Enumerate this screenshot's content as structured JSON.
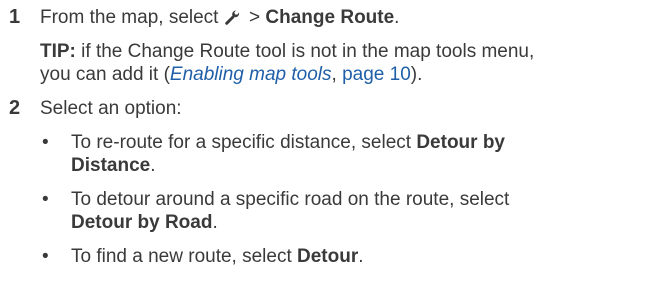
{
  "steps": [
    {
      "number": "1",
      "text_before": "From the map, select ",
      "icon": "wrench-icon",
      "separator": " > ",
      "action": "Change Route",
      "text_after": "."
    },
    {
      "number": "2",
      "text": "Select an option:"
    }
  ],
  "tip": {
    "label": "TIP:",
    "text_line1": " if the Change Route tool is not in the map tools menu,",
    "text_line2_before": "you can add it (",
    "link_text": "Enabling map tools",
    "comma": ", ",
    "page_ref": "page 10",
    "text_line2_after": ")."
  },
  "options": [
    {
      "bullet": "•",
      "line1": "To re-route for a specific distance, select ",
      "bold1": "Detour by",
      "bold2": "Distance",
      "after": "."
    },
    {
      "bullet": "•",
      "line1": "To detour around a specific road on the route, select",
      "bold": "Detour by Road",
      "after": "."
    },
    {
      "bullet": "•",
      "text": "To find a new route, select ",
      "bold": "Detour",
      "after": "."
    }
  ],
  "colors": {
    "text": "#3a3a3a",
    "link": "#1f5fa8"
  }
}
